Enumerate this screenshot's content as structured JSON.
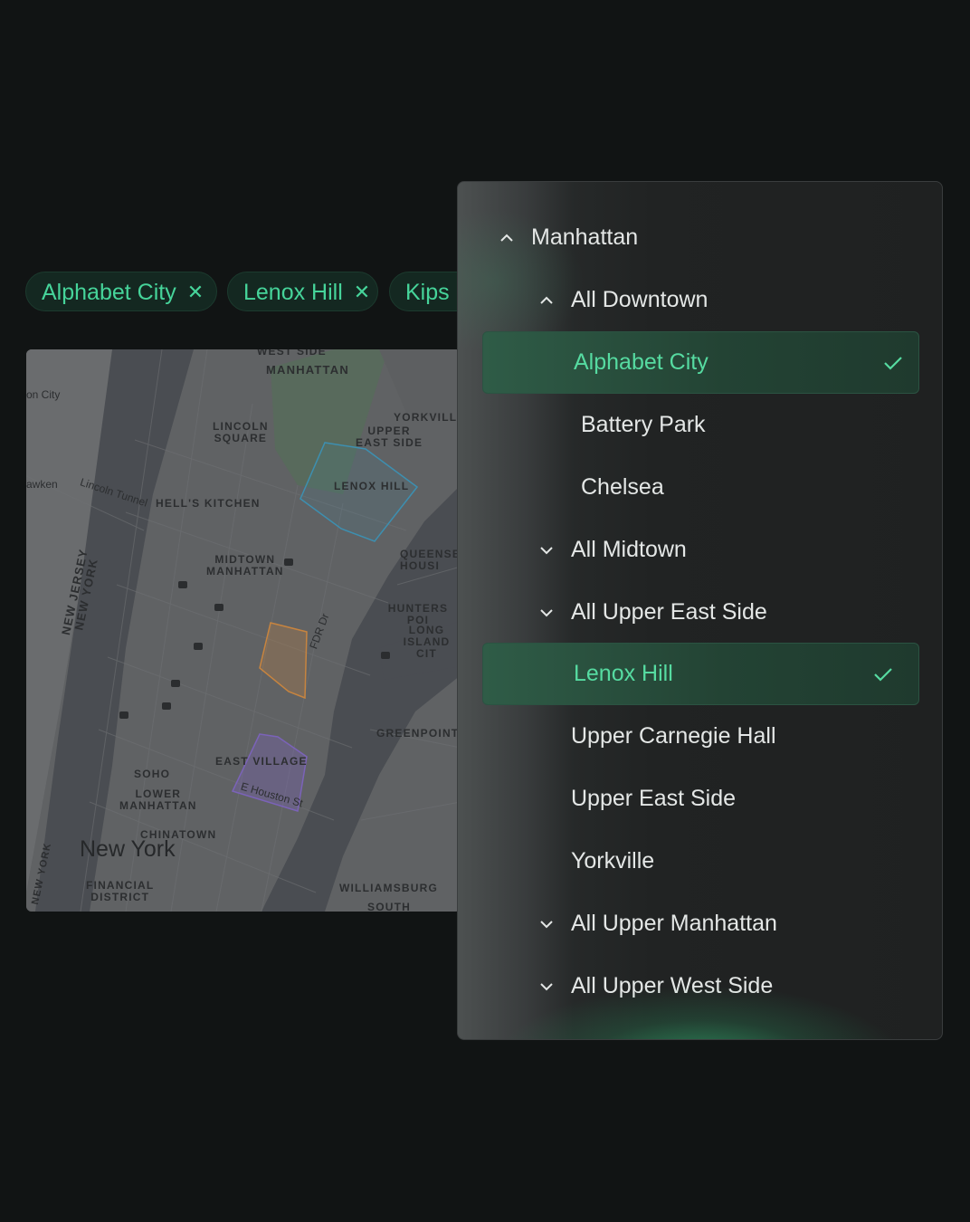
{
  "chips": [
    {
      "label": "Alphabet City",
      "remove_icon": "close-icon"
    },
    {
      "label": "Lenox Hill",
      "remove_icon": "close-icon"
    },
    {
      "label": "Kips Bay",
      "remove_icon": "close-icon"
    }
  ],
  "map": {
    "labels": {
      "west_side": "WEST SIDE",
      "manhattan": "MANHATTAN",
      "union_city": "on City",
      "yorkville": "YORKVILLE",
      "lincoln_square": "LINCOLN\nSQUARE",
      "upper_east_side": "UPPER\nEAST SIDE",
      "weehawken": "awken",
      "lincoln_tunnel": "Lincoln Tunnel",
      "hells_kitchen": "HELL'S KITCHEN",
      "lenox_hill": "LENOX HILL",
      "queensbridge": "QUEENSBI\nHOUSI",
      "midtown": "MIDTOWN\nMANHATTAN",
      "nj_ny": "NEW JERSEY\nNEW YORK",
      "hunters_point": "HUNTERS POI",
      "lic": "LONG\nISLAND CIT",
      "greenpoint": "GREENPOINT",
      "east_village": "EAST VILLAGE",
      "soho": "SOHO",
      "lower_manhattan": "LOWER\nMANHATTAN",
      "chinatown": "CHINATOWN",
      "new_york": "New York",
      "new_york_vert": "NEW YORK",
      "financial": "FINANCIAL\nDISTRICT",
      "williamsburg": "WILLIAMSBURG",
      "south": "SOUTH",
      "houston": "E Houston St",
      "fdr": "FDR Dr"
    },
    "highlight_colors": {
      "lenox_hill": "#3d8fb0",
      "kips_bay": "#c7843f",
      "east_village": "#7b63b8"
    }
  },
  "dropdown": {
    "rows": [
      {
        "label": "Manhattan",
        "level": 0,
        "chevron": "chevron-up-icon",
        "selected": false
      },
      {
        "label": "All Downtown",
        "level": 1,
        "chevron": "chevron-up-icon",
        "selected": false
      },
      {
        "label": "Alphabet City",
        "level": 2,
        "chevron": "",
        "selected": true
      },
      {
        "label": "Battery Park",
        "level": 2,
        "chevron": "",
        "selected": false
      },
      {
        "label": "Chelsea",
        "level": 2,
        "chevron": "",
        "selected": false
      },
      {
        "label": "All Midtown",
        "level": 1,
        "chevron": "chevron-down-icon",
        "selected": false
      },
      {
        "label": "All Upper East Side",
        "level": 1,
        "chevron": "chevron-down-icon",
        "selected": false
      },
      {
        "label": "Lenox Hill",
        "level": 3,
        "chevron": "",
        "selected": true
      },
      {
        "label": "Upper Carnegie Hall",
        "level": 3,
        "chevron": "",
        "selected": false
      },
      {
        "label": "Upper East Side",
        "level": 3,
        "chevron": "",
        "selected": false
      },
      {
        "label": "Yorkville",
        "level": 3,
        "chevron": "",
        "selected": false
      },
      {
        "label": "All Upper Manhattan",
        "level": 1,
        "chevron": "chevron-down-icon",
        "selected": false
      },
      {
        "label": "All Upper West Side",
        "level": 1,
        "chevron": "chevron-down-icon",
        "selected": false
      }
    ],
    "accent_color": "#46d49a"
  }
}
